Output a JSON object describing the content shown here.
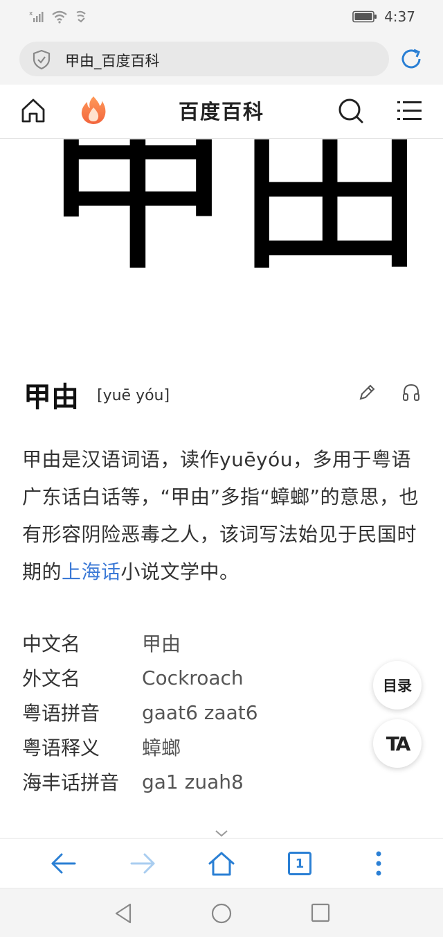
{
  "status_bar": {
    "time": "4:37",
    "icons": [
      "no-sim-signal-icon",
      "wifi-icon",
      "nfc-icon",
      "battery-icon"
    ]
  },
  "url_bar": {
    "text": "甲由_百度百科",
    "icons": [
      "shield-icon",
      "reload-icon"
    ]
  },
  "nav": {
    "title": "百度百科",
    "icons": [
      "home-icon",
      "fire-icon",
      "search-icon",
      "menu-icon"
    ]
  },
  "hero": {
    "text": "甲由"
  },
  "entry": {
    "title": "甲由",
    "pinyin": "[yuē yóu]",
    "icons": [
      "edit-icon",
      "audio-icon"
    ]
  },
  "summary": {
    "before_link": "甲由是汉语词语，读作yuēyóu，多用于粤语广东话白话等，“甲由”多指“蟑螂”的意思，也有形容阴险恶毒之人，该词写法始见于民国时期的",
    "link": "上海话",
    "after_link": "小说文学中。",
    "link_color": "#3b79d6"
  },
  "info_box": [
    {
      "label": "中文名",
      "value": "甲由"
    },
    {
      "label": "外文名",
      "value": "Cockroach"
    },
    {
      "label": "粤语拼音",
      "value": "gaat6 zaat6"
    },
    {
      "label": "粤语释义",
      "value": "蟑螂"
    },
    {
      "label": "海丰话拼音",
      "value": "ga1 zuah8"
    }
  ],
  "floating": {
    "toc_label": "目录",
    "ta_label": "TA"
  },
  "browser_toolbar": {
    "tab_count": "1",
    "accent_color": "#2a7fd4",
    "icons": [
      "back-arrow-icon",
      "forward-arrow-icon",
      "home-icon",
      "tabs-icon",
      "more-icon"
    ]
  },
  "system_nav": {
    "icons": [
      "back-triangle-icon",
      "home-circle-icon",
      "recents-square-icon"
    ]
  }
}
